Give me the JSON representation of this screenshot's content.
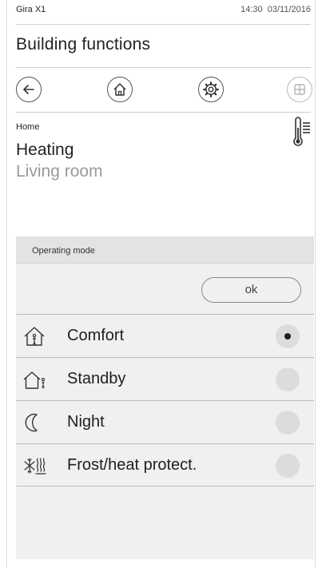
{
  "status_bar": {
    "device_name": "Gira X1",
    "time": "14:30",
    "date": "03/11/2016"
  },
  "page_title": "Building functions",
  "nav": {
    "back_icon": "arrow-left-icon",
    "home_icon": "house-icon",
    "settings_icon": "gear-icon",
    "grid_icon": "grid-icon"
  },
  "breadcrumb": "Home",
  "function": {
    "type": "Heating",
    "room": "Living room",
    "icon": "thermometer-icon"
  },
  "operating_mode": {
    "header": "Operating mode",
    "ok_label": "ok",
    "selected": "Comfort",
    "options": [
      {
        "label": "Comfort",
        "icon": "house-person-icon",
        "selected": true
      },
      {
        "label": "Standby",
        "icon": "house-walking-person-icon",
        "selected": false
      },
      {
        "label": "Night",
        "icon": "moon-icon",
        "selected": false
      },
      {
        "label": "Frost/heat protect.",
        "icon": "frost-heat-icon",
        "selected": false
      }
    ]
  }
}
